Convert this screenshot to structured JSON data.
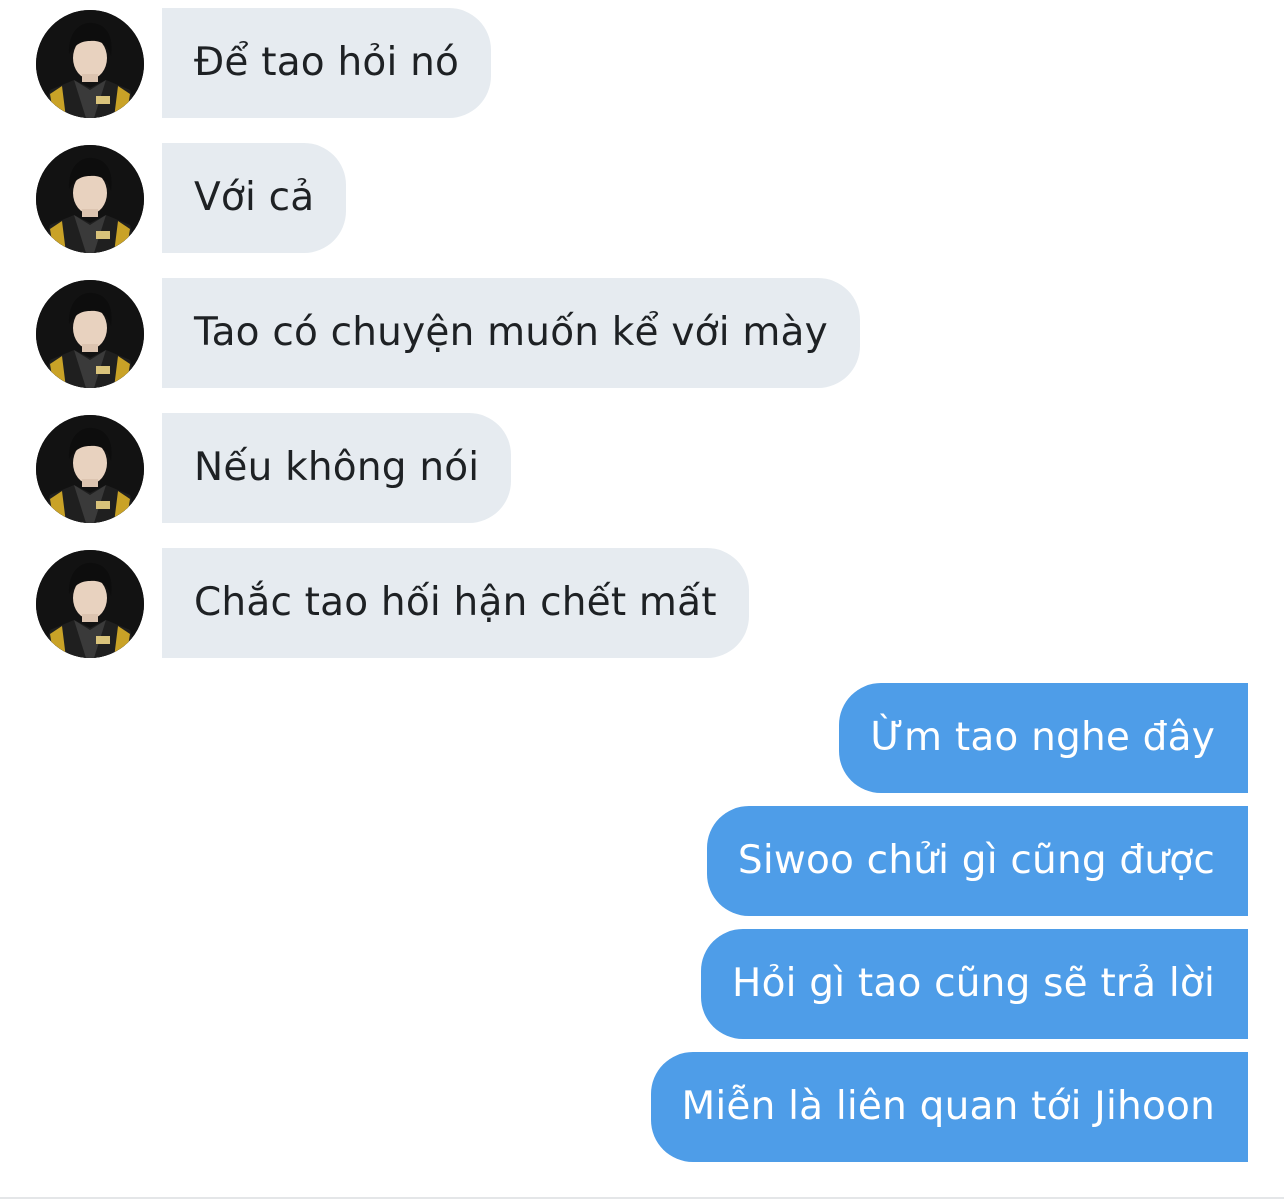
{
  "conversation": {
    "incoming": [
      {
        "text": "Để tao hỏi nó",
        "avatar": "profile-photo-icon"
      },
      {
        "text": "Với cả",
        "avatar": "profile-photo-icon"
      },
      {
        "text": "Tao có chuyện muốn kể với mày",
        "avatar": "profile-photo-icon"
      },
      {
        "text": "Nếu không nói",
        "avatar": "profile-photo-icon"
      },
      {
        "text": "Chắc tao hối hận chết mất",
        "avatar": "profile-photo-icon"
      }
    ],
    "outgoing": [
      {
        "text": "Ừm tao nghe đây"
      },
      {
        "text": "Siwoo chửi gì cũng được"
      },
      {
        "text": "Hỏi gì tao cũng sẽ trả lời"
      },
      {
        "text": "Miễn là liên quan tới Jihoon"
      }
    ]
  },
  "colors": {
    "incoming_bubble": "#e6ebf0",
    "outgoing_bubble": "#4e9de8",
    "incoming_text": "#1e2124",
    "outgoing_text": "#ffffff",
    "jersey_accent": "#c9a227"
  }
}
